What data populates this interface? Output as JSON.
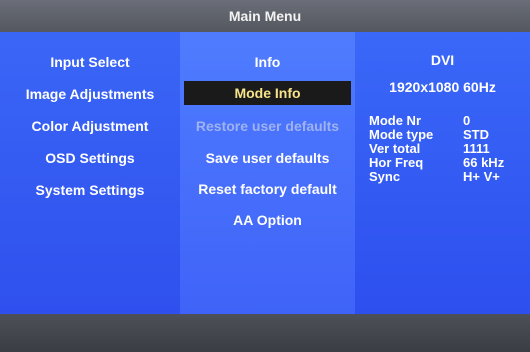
{
  "header": {
    "title": "Main Menu"
  },
  "left_menu": [
    "Input Select",
    "Image Adjustments",
    "Color Adjustment",
    "OSD Settings",
    "System Settings"
  ],
  "mid_menu": {
    "items": [
      {
        "label": "Info",
        "state": "normal"
      },
      {
        "label": "Mode Info",
        "state": "selected"
      },
      {
        "label": "Restore user defaults",
        "state": "disabled"
      },
      {
        "label": "Save user defaults",
        "state": "normal"
      },
      {
        "label": "Reset factory default",
        "state": "normal"
      },
      {
        "label": "AA Option",
        "state": "normal"
      }
    ]
  },
  "info": {
    "input": "DVI",
    "resolution": "1920x1080 60Hz",
    "rows": [
      {
        "key": "Mode Nr",
        "value": "0"
      },
      {
        "key": "Mode type",
        "value": "STD"
      },
      {
        "key": "Ver total",
        "value": "1111"
      },
      {
        "key": "Hor Freq",
        "value": "66 kHz"
      },
      {
        "key": "Sync",
        "value": "H+ V+"
      }
    ]
  },
  "colors": {
    "selected_bg": "#1a1a1a",
    "selected_text": "#f6e38a",
    "disabled_text": "#9fb2ef"
  }
}
